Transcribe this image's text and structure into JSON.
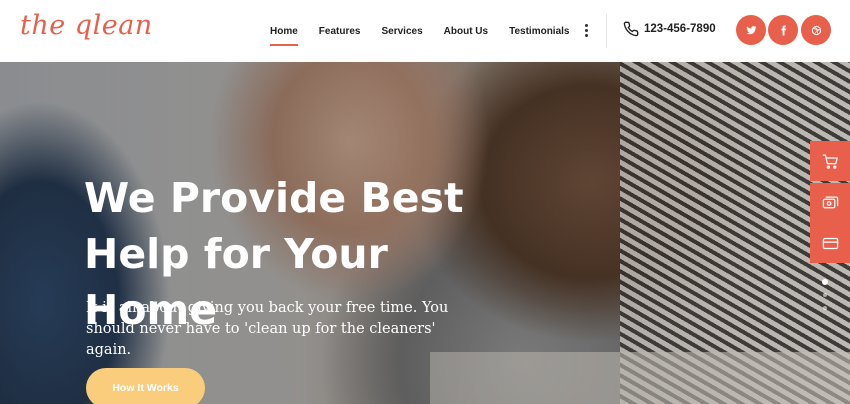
{
  "brand": {
    "logo_text": "the qlean",
    "accent_color": "#e8604c",
    "cta_color": "#f9cd7b"
  },
  "nav": {
    "items": [
      {
        "label": "Home",
        "active": true
      },
      {
        "label": "Features",
        "active": false
      },
      {
        "label": "Services",
        "active": false
      },
      {
        "label": "About Us",
        "active": false
      },
      {
        "label": "Testimonials",
        "active": false
      }
    ],
    "more_icon": "more-vertical-icon"
  },
  "contact": {
    "phone": "123-456-7890",
    "icon": "phone-icon"
  },
  "social": [
    {
      "name": "twitter-icon"
    },
    {
      "name": "facebook-icon"
    },
    {
      "name": "dribbble-icon"
    }
  ],
  "hero": {
    "title_line1": "We Provide Best",
    "title_line2": "Help for Your Home",
    "description": "It is all about giving you back your free time. You should never have to 'clean up for the cleaners' again.",
    "cta_label": "How It Works"
  },
  "side_tools": [
    {
      "name": "cart-icon"
    },
    {
      "name": "money-icon"
    },
    {
      "name": "card-icon"
    }
  ],
  "slider": {
    "slides": 3,
    "active_index": 0
  }
}
